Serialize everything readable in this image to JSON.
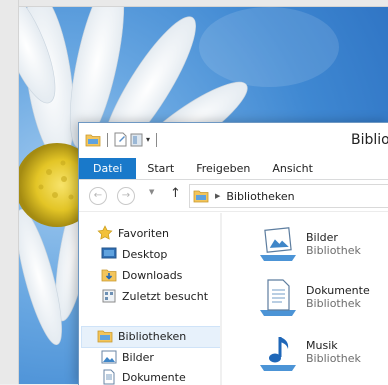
{
  "window": {
    "title": "Biblio"
  },
  "ribbon": {
    "tabs": [
      "Datei",
      "Start",
      "Freigeben",
      "Ansicht"
    ]
  },
  "address": {
    "path": "Bibliotheken"
  },
  "navpane": {
    "favorites_label": "Favoriten",
    "favorites": [
      "Desktop",
      "Downloads",
      "Zuletzt besucht"
    ],
    "libraries_label": "Bibliotheken",
    "libraries": [
      "Bilder",
      "Dokumente"
    ]
  },
  "content": {
    "items": [
      {
        "name": "Bilder",
        "type": "Bibliothek",
        "icon": "pictures-library-icon"
      },
      {
        "name": "Dokumente",
        "type": "Bibliothek",
        "icon": "documents-library-icon"
      },
      {
        "name": "Musik",
        "type": "Bibliothek",
        "icon": "music-library-icon"
      }
    ]
  },
  "colors": {
    "accent": "#1979ca",
    "selection": "#e7f1fb",
    "desktop_blue": "#3f88d2"
  }
}
